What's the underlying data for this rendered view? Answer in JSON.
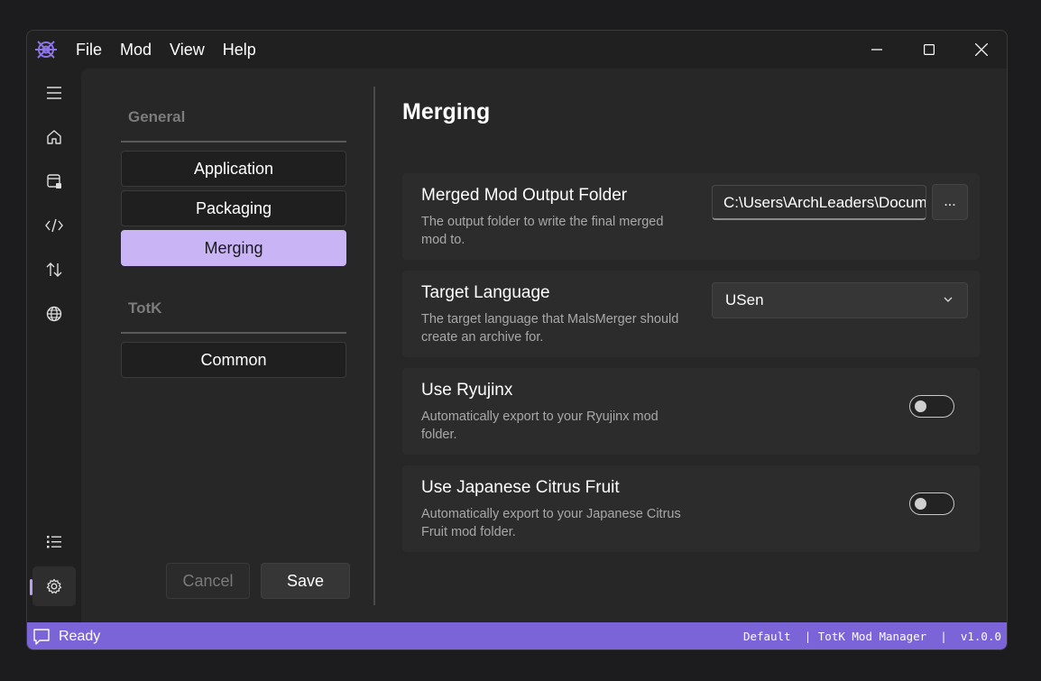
{
  "menu": {
    "items": [
      {
        "label": "File"
      },
      {
        "label": "Mod"
      },
      {
        "label": "View"
      },
      {
        "label": "Help"
      }
    ]
  },
  "rail": {
    "icons": [
      "hamburger-icon",
      "home-icon",
      "mod-storage-icon",
      "code-icon",
      "sort-arrows-icon",
      "globe-icon",
      "list-icon",
      "gear-icon"
    ]
  },
  "nav": {
    "general_header": "General",
    "totk_header": "TotK",
    "items": [
      {
        "label": "Application"
      },
      {
        "label": "Packaging"
      },
      {
        "label": "Merging"
      },
      {
        "label": "Common"
      }
    ],
    "cancel_label": "Cancel",
    "save_label": "Save"
  },
  "page": {
    "title": "Merging",
    "settings": [
      {
        "title": "Merged Mod Output Folder",
        "description": "The output folder to write the final merged mod to.",
        "value": "C:\\Users\\ArchLeaders\\Documents",
        "browse_label": "..."
      },
      {
        "title": "Target Language",
        "description": "The target language that MalsMerger should create an archive for.",
        "value": "USen"
      },
      {
        "title": "Use Ryujinx",
        "description": "Automatically export to your Ryujinx mod folder."
      },
      {
        "title": "Use Japanese Citrus Fruit",
        "description": "Automatically export to your Japanese Citrus Fruit mod folder."
      }
    ]
  },
  "status": {
    "text": "Ready",
    "profile": "Default",
    "separator": "|",
    "app_name": "TotK Mod Manager",
    "version": "v1.0.0"
  },
  "colors": {
    "accent": "#7a64d8",
    "selected": "#c9b5f5"
  }
}
